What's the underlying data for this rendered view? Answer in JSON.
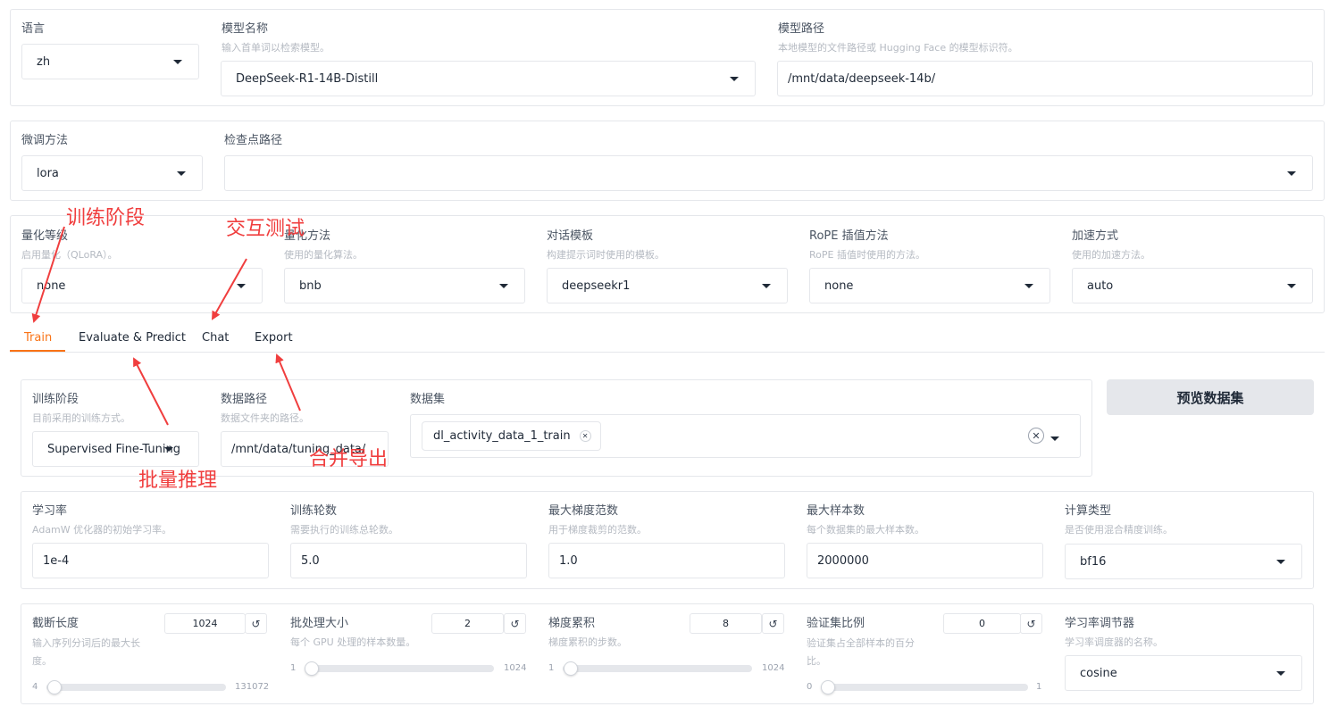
{
  "top": {
    "lang": {
      "label": "语言",
      "value": "zh"
    },
    "model_name": {
      "label": "模型名称",
      "hint": "输入首单词以检索模型。",
      "value": "DeepSeek-R1-14B-Distill"
    },
    "model_path": {
      "label": "模型路径",
      "hint": "本地模型的文件路径或 Hugging Face 的模型标识符。",
      "value": "/mnt/data/deepseek-14b/"
    }
  },
  "finetune": {
    "method": {
      "label": "微调方法",
      "value": "lora"
    },
    "checkpoint": {
      "label": "检查点路径",
      "value": ""
    }
  },
  "advanced": {
    "quant_bit": {
      "label": "量化等级",
      "hint": "启用量化（QLoRA）。",
      "value": "none"
    },
    "quant_method": {
      "label": "量化方法",
      "hint": "使用的量化算法。",
      "value": "bnb"
    },
    "template": {
      "label": "对话模板",
      "hint": "构建提示词时使用的模板。",
      "value": "deepseekr1"
    },
    "rope": {
      "label": "RoPE 插值方法",
      "hint": "RoPE 插值时使用的方法。",
      "value": "none"
    },
    "booster": {
      "label": "加速方式",
      "hint": "使用的加速方法。",
      "value": "auto"
    }
  },
  "tabs": [
    "Train",
    "Evaluate & Predict",
    "Chat",
    "Export"
  ],
  "active_tab": "Train",
  "train": {
    "stage": {
      "label": "训练阶段",
      "hint": "目前采用的训练方式。",
      "value": "Supervised Fine-Tuning"
    },
    "dataset_dir": {
      "label": "数据路径",
      "hint": "数据文件夹的路径。",
      "value": "/mnt/data/tuning_data/"
    },
    "dataset": {
      "label": "数据集",
      "chips": [
        "dl_activity_data_1_train"
      ],
      "clear_icon": "✕"
    },
    "preview_button": "预览数据集",
    "learning_rate": {
      "label": "学习率",
      "hint": "AdamW 优化器的初始学习率。",
      "value": "1e-4"
    },
    "num_epochs": {
      "label": "训练轮数",
      "hint": "需要执行的训练总轮数。",
      "value": "5.0"
    },
    "max_grad_norm": {
      "label": "最大梯度范数",
      "hint": "用于梯度裁剪的范数。",
      "value": "1.0"
    },
    "max_samples": {
      "label": "最大样本数",
      "hint": "每个数据集的最大样本数。",
      "value": "2000000"
    },
    "compute_type": {
      "label": "计算类型",
      "hint": "是否使用混合精度训练。",
      "value": "bf16"
    },
    "cutoff_len": {
      "label": "截断长度",
      "hint": "输入序列分词后的最大长度。",
      "value": "1024",
      "min": "4",
      "max": "131072",
      "fraction": 0.008
    },
    "batch_size": {
      "label": "批处理大小",
      "hint": "每个 GPU 处理的样本数量。",
      "value": "2",
      "min": "1",
      "max": "1024",
      "fraction": 0.001
    },
    "grad_accum": {
      "label": "梯度累积",
      "hint": "梯度累积的步数。",
      "value": "8",
      "min": "1",
      "max": "1024",
      "fraction": 0.007
    },
    "val_size": {
      "label": "验证集比例",
      "hint": "验证集占全部样本的百分比。",
      "value": "0",
      "min": "0",
      "max": "1",
      "fraction": 0.0
    },
    "lr_scheduler": {
      "label": "学习率调节器",
      "hint": "学习率调度器的名称。",
      "value": "cosine"
    },
    "reset_icon": "↺"
  },
  "annotations": {
    "train_stage": "训练阶段",
    "chat_test": "交互测试",
    "batch_infer": "批量推理",
    "merge_export": "合并导出"
  },
  "colors": {
    "accent": "#f97316",
    "annotation": "#f03e3e",
    "border": "#e5e7eb"
  }
}
